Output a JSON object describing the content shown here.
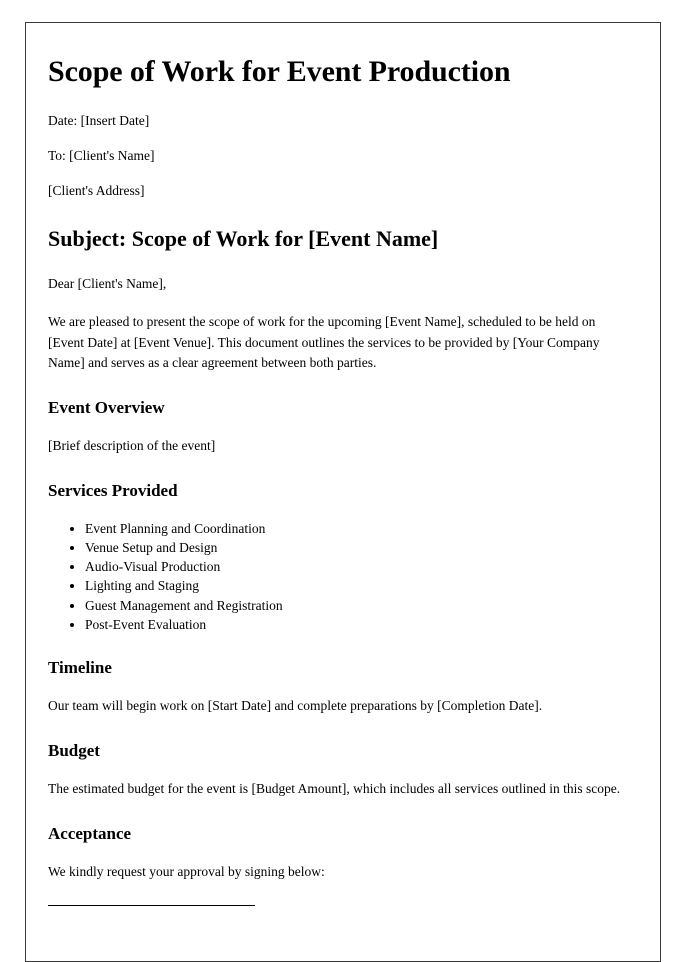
{
  "document": {
    "title": "Scope of Work for Event Production",
    "meta": [
      "Date: [Insert Date]",
      "To: [Client's Name]",
      "[Client's Address]"
    ],
    "subject_heading": "Subject: Scope of Work for [Event Name]",
    "salutation": "Dear [Client's Name],",
    "intro_paragraph": "We are pleased to present the scope of work for the upcoming [Event Name], scheduled to be held on [Event Date] at [Event Venue]. This document outlines the services to be provided by [Your Company Name] and serves as a clear agreement between both parties.",
    "sections": {
      "event_overview": {
        "heading": "Event Overview",
        "body": "[Brief description of the event]"
      },
      "services_provided": {
        "heading": "Services Provided",
        "items": [
          "Event Planning and Coordination",
          "Venue Setup and Design",
          "Audio-Visual Production",
          "Lighting and Staging",
          "Guest Management and Registration",
          "Post-Event Evaluation"
        ]
      },
      "timeline": {
        "heading": "Timeline",
        "body": "Our team will begin work on [Start Date] and complete preparations by [Completion Date]."
      },
      "budget": {
        "heading": "Budget",
        "body": "The estimated budget for the event is [Budget Amount], which includes all services outlined in this scope."
      },
      "acceptance": {
        "heading": "Acceptance",
        "body": "We kindly request your approval by signing below:"
      }
    },
    "colors": {
      "text": "#000000",
      "page_background": "#ffffff",
      "page_border": "#3a3a3a",
      "signature_rule": "#000000"
    }
  }
}
